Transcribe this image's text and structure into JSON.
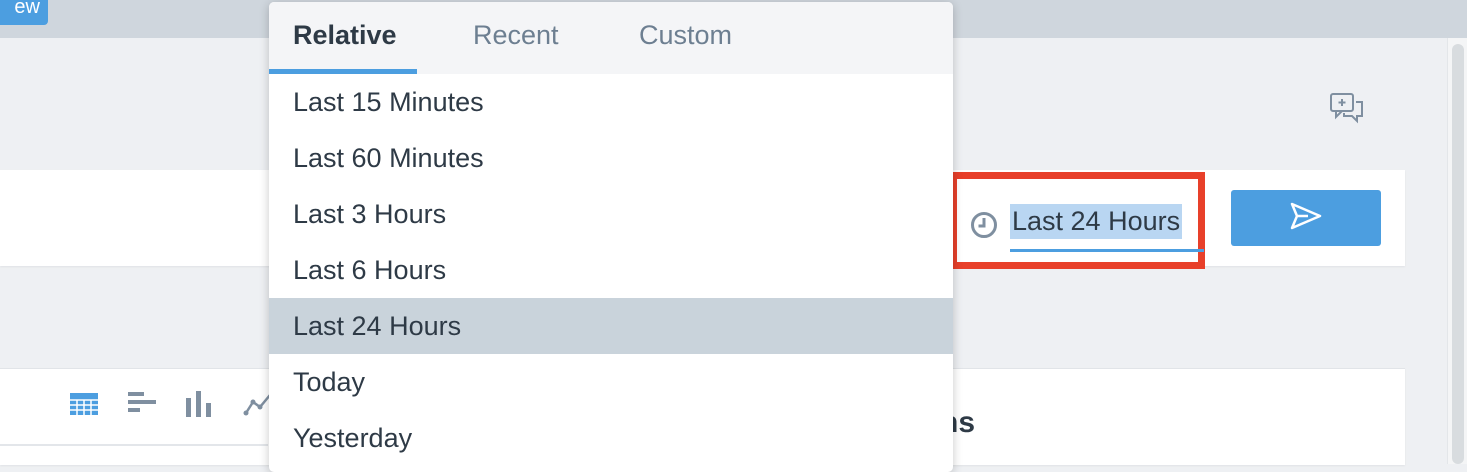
{
  "topbar": {
    "new_button_label": "ew"
  },
  "query": {
    "time_range_label": "Last 24 Hours",
    "send_icon": "send-icon",
    "clock_icon": "clock-icon"
  },
  "panel": {
    "heading_fragment": "ns",
    "viz_icons": [
      "table-icon",
      "horizontal-bar-icon",
      "vertical-bar-icon",
      "line-chart-icon"
    ]
  },
  "dropdown": {
    "tabs": [
      {
        "label": "Relative",
        "active": true
      },
      {
        "label": "Recent",
        "active": false
      },
      {
        "label": "Custom",
        "active": false
      }
    ],
    "options": [
      {
        "label": "Last 15 Minutes"
      },
      {
        "label": "Last 60 Minutes"
      },
      {
        "label": "Last 3 Hours"
      },
      {
        "label": "Last 6 Hours"
      },
      {
        "label": "Last 24 Hours",
        "selected": true
      },
      {
        "label": "Today"
      },
      {
        "label": "Yesterday"
      }
    ]
  },
  "colors": {
    "accent": "#4c9ee0",
    "highlight_border": "#e8402a",
    "selected_row": "#c9d3db",
    "text_selection": "#b9d6f2"
  }
}
